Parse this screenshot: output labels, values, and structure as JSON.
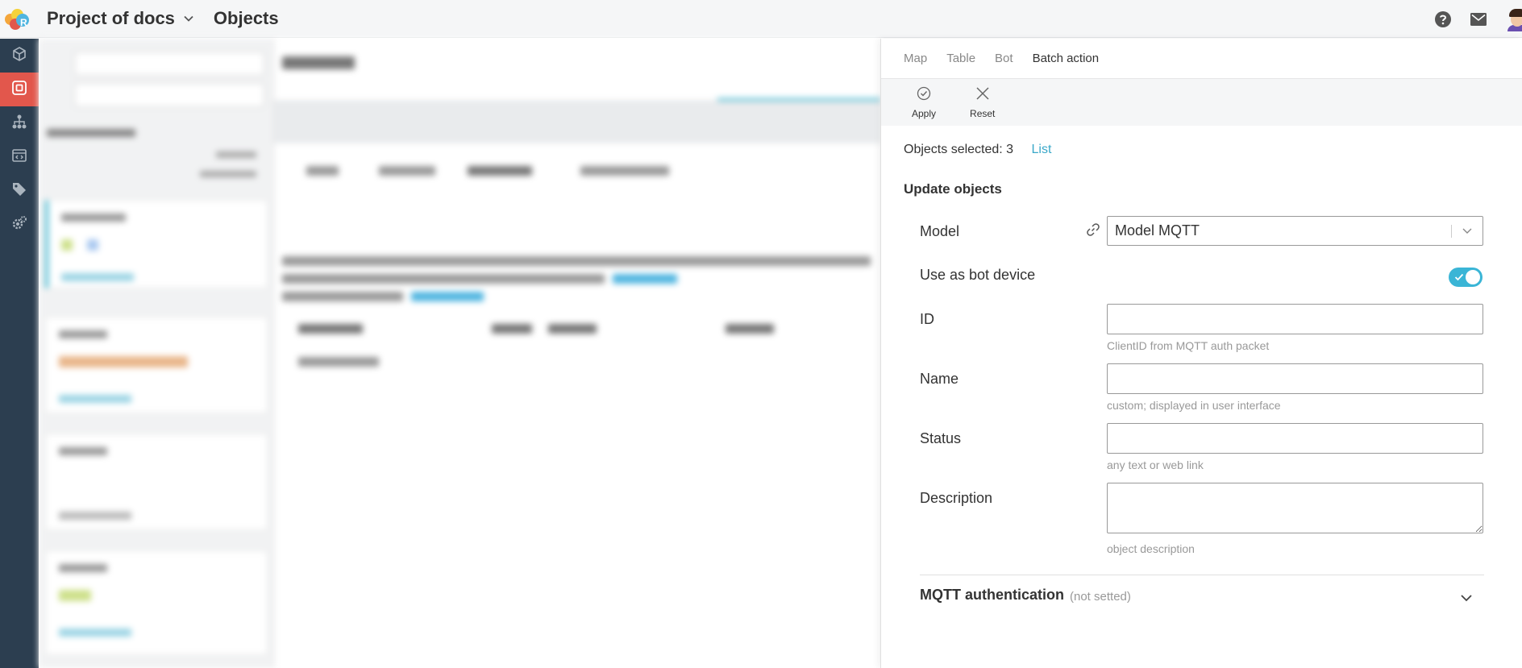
{
  "header": {
    "project_name": "Project of docs",
    "section_title": "Objects"
  },
  "icons": {
    "help": "help-circle-icon",
    "mail": "envelope-icon",
    "avatar": "user-avatar"
  },
  "sidebar": {
    "items": [
      {
        "icon": "cube-icon",
        "active": false
      },
      {
        "icon": "objects-icon",
        "active": true
      },
      {
        "icon": "hierarchy-icon",
        "active": false
      },
      {
        "icon": "code-window-icon",
        "active": false
      },
      {
        "icon": "tag-icon",
        "active": false
      },
      {
        "icon": "gears-icon",
        "active": false
      }
    ]
  },
  "panel": {
    "tabs": [
      {
        "label": "Map",
        "active": false
      },
      {
        "label": "Table",
        "active": false
      },
      {
        "label": "Bot",
        "active": false
      },
      {
        "label": "Batch action",
        "active": true
      }
    ],
    "toolbar": {
      "apply_label": "Apply",
      "reset_label": "Reset"
    },
    "selection": {
      "text": "Objects selected: 3",
      "list_link": "List"
    },
    "update_title": "Update objects",
    "model": {
      "label": "Model",
      "value": "Model MQTT"
    },
    "bot_device": {
      "label": "Use as bot device",
      "enabled": true
    },
    "id_field": {
      "label": "ID",
      "value": "",
      "hint": "ClientID from MQTT auth packet"
    },
    "name_field": {
      "label": "Name",
      "value": "",
      "hint": "custom; displayed in user interface"
    },
    "status_field": {
      "label": "Status",
      "value": "",
      "hint": "any text or web link"
    },
    "description_field": {
      "label": "Description",
      "value": "",
      "hint": "object description"
    },
    "mqtt": {
      "title": "MQTT authentication",
      "status": "(not setted)"
    }
  },
  "colors": {
    "sidebar_bg": "#2c3e50",
    "sidebar_active": "#e2574c",
    "accent": "#3ab5d6",
    "link": "#3aa8c9"
  }
}
